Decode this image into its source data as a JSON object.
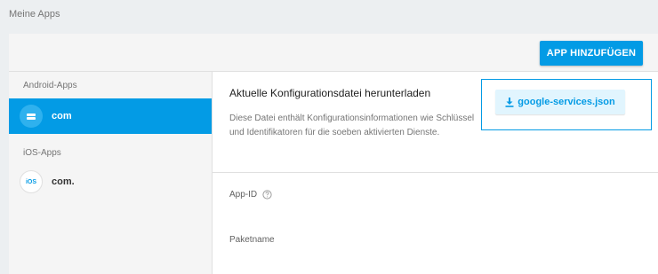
{
  "page": {
    "title": "Meine Apps"
  },
  "header": {
    "add_app_label": "APP HINZUFÜGEN"
  },
  "sidebar": {
    "android_label": "Android-Apps",
    "android_apps": [
      {
        "name": "com",
        "icon": "android-app-icon"
      }
    ],
    "ios_label": "iOS-Apps",
    "ios_apps": [
      {
        "name": "com.",
        "icon_text": "iOS"
      }
    ]
  },
  "main": {
    "download_title": "Aktuelle Konfigurationsdatei herunterladen",
    "download_description": "Diese Datei enthält Konfigurationsinformationen wie Schlüssel und Identifikatoren für die soeben aktivierten Dienste.",
    "download_button_label": "google-services.json",
    "download_icon": "download-icon",
    "app_id_label": "App-ID",
    "help_icon": "help-circle-icon",
    "package_name_label": "Paketname"
  },
  "colors": {
    "accent": "#039be5",
    "background": "#eceff1",
    "selected_item": "#039be5",
    "download_button_bg": "#e1f5fe"
  }
}
